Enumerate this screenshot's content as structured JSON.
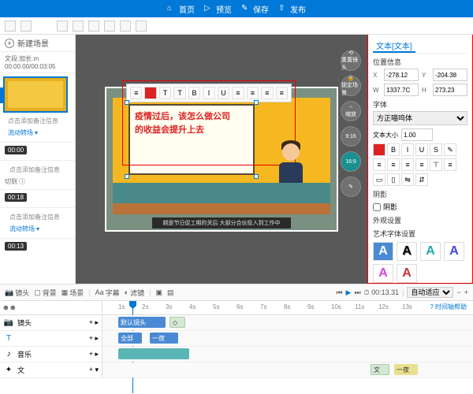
{
  "topbar": {
    "home": "首页",
    "preview": "预览",
    "save": "保存",
    "publish": "发布"
  },
  "left": {
    "newscene": "新建场景",
    "fileinfo": "文段:加长.m 00:00.00/00:03:05",
    "captiontip": "点击添加备注信息",
    "flow": "流动转场",
    "cut": "切到",
    "times": [
      "00:00",
      "00:18",
      "00:13"
    ]
  },
  "canvas": {
    "boardtext1": "疫情过后，该怎么做公司",
    "boardtext2": "的收益会提升上去",
    "subtitle": "越是节日促工期的关后 大部分合伙投入到工作中",
    "sidetools": {
      "reset": "重置镜头",
      "lock": "锁定场景",
      "zoom": "缩放",
      "ratio": "9:16",
      "alt": "16:9"
    }
  },
  "right": {
    "tab1": "文本",
    "tab1b": "[文本]",
    "sec_pos": "位置信息",
    "x": "-278.12",
    "y": "-204.38",
    "w": "1337.7C",
    "h": "273.23",
    "sec_font": "字体",
    "fontname": "方正喵呜体",
    "sizelabel": "文本大小",
    "size": "1.00",
    "shadow": "阴影",
    "outline": "外观设置",
    "art": "艺术字体设置"
  },
  "midbar": {
    "lens": "镜头",
    "bg": "背景",
    "scene": "场景",
    "caption": "字幕",
    "filter": "滤镜",
    "time": "00:13.31",
    "auto": "自动适应"
  },
  "timeline": {
    "help": "时间轴帮助",
    "t_lens": "镜头",
    "t_text": "T",
    "t_audio": "音乐",
    "t_fx": "文",
    "cliplabel": "默认镜头",
    "clipall": "全部",
    "ticks": [
      "1s",
      "2s",
      "3s",
      "4s",
      "5s",
      "6s",
      "7s",
      "8s",
      "9s",
      "10s",
      "11s",
      "12s",
      "13s"
    ],
    "txtclip": "文",
    "txtclip2": "一夜"
  }
}
